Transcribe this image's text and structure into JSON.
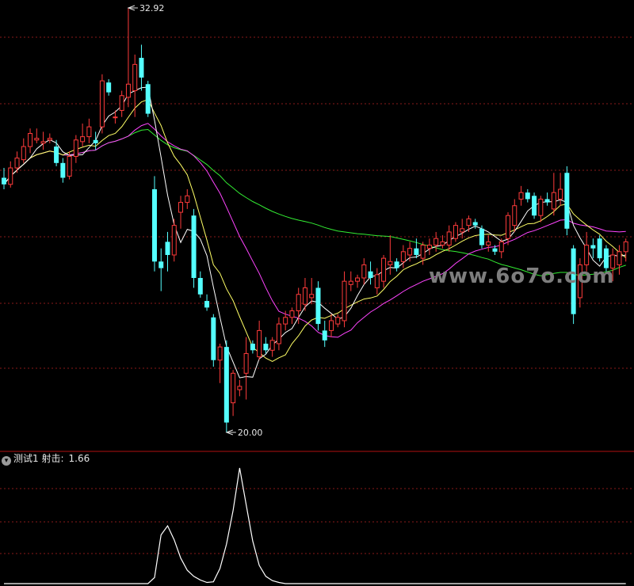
{
  "watermark": "www.6o7o.com",
  "indicator": {
    "name": "测试1",
    "label": "射击:",
    "value": "1.66"
  },
  "colors": {
    "up": "#ff3b3b",
    "down": "#54ffff",
    "ma5": "#ffffff",
    "ma10": "#ffff66",
    "ma20": "#ff44ff",
    "ma60": "#33ee33",
    "grid": "#8a1a1a",
    "separator": "#b01010",
    "indicator_line": "#ffffff"
  },
  "chart_data": [
    {
      "type": "candlestick",
      "ylim": [
        20.0,
        32.92
      ],
      "annotations": [
        {
          "label": "32.92",
          "value": 32.92,
          "kind": "high"
        },
        {
          "label": "20.00",
          "value": 20.0,
          "kind": "low"
        }
      ],
      "ohlc": [
        [
          27.75,
          28.05,
          27.4,
          27.55
        ],
        [
          27.55,
          28.25,
          27.45,
          28.05
        ],
        [
          28.05,
          28.55,
          27.9,
          28.35
        ],
        [
          28.3,
          28.95,
          28.2,
          28.7
        ],
        [
          28.7,
          29.25,
          28.5,
          29.1
        ],
        [
          28.9,
          29.25,
          28.8,
          28.95
        ],
        [
          28.8,
          29.15,
          28.6,
          28.85
        ],
        [
          28.9,
          29.1,
          28.8,
          28.95
        ],
        [
          28.7,
          28.9,
          28.1,
          28.2
        ],
        [
          28.2,
          28.35,
          27.6,
          27.75
        ],
        [
          27.8,
          28.55,
          27.7,
          28.4
        ],
        [
          28.4,
          29.05,
          28.2,
          28.9
        ],
        [
          28.85,
          29.4,
          28.7,
          29.0
        ],
        [
          29.0,
          29.55,
          28.8,
          29.3
        ],
        [
          28.9,
          29.15,
          28.6,
          28.8
        ],
        [
          29.3,
          30.9,
          29.1,
          30.7
        ],
        [
          30.65,
          30.75,
          30.25,
          30.35
        ],
        [
          29.6,
          29.8,
          29.4,
          29.6
        ],
        [
          29.8,
          30.4,
          29.6,
          30.25
        ],
        [
          30.2,
          32.92,
          29.9,
          30.6
        ],
        [
          30.4,
          31.5,
          29.6,
          31.2
        ],
        [
          31.4,
          31.8,
          30.4,
          30.8
        ],
        [
          30.6,
          30.7,
          29.6,
          29.7
        ],
        [
          27.4,
          27.8,
          24.9,
          25.2
        ],
        [
          25.2,
          25.6,
          24.3,
          25.0
        ],
        [
          25.8,
          26.1,
          24.9,
          25.4
        ],
        [
          25.4,
          26.5,
          25.2,
          26.3
        ],
        [
          26.7,
          27.2,
          26.2,
          27.0
        ],
        [
          27.0,
          27.4,
          26.8,
          27.2
        ],
        [
          26.6,
          26.8,
          24.4,
          24.7
        ],
        [
          24.7,
          24.9,
          24.1,
          24.2
        ],
        [
          24.0,
          24.2,
          23.7,
          23.8
        ],
        [
          23.5,
          23.6,
          22.0,
          22.2
        ],
        [
          22.2,
          22.7,
          21.5,
          22.6
        ],
        [
          22.6,
          22.8,
          20.0,
          20.3
        ],
        [
          20.9,
          21.9,
          20.5,
          21.8
        ],
        [
          21.3,
          21.6,
          21.1,
          21.4
        ],
        [
          21.8,
          22.9,
          21.0,
          22.4
        ],
        [
          22.7,
          22.8,
          22.4,
          22.5
        ],
        [
          22.3,
          23.4,
          22.2,
          23.1
        ],
        [
          22.7,
          22.9,
          22.4,
          22.5
        ],
        [
          22.5,
          22.9,
          22.3,
          22.8
        ],
        [
          22.7,
          23.5,
          22.5,
          23.3
        ],
        [
          23.3,
          23.7,
          23.1,
          23.5
        ],
        [
          23.5,
          23.8,
          23.3,
          23.7
        ],
        [
          23.7,
          24.4,
          23.3,
          24.2
        ],
        [
          23.9,
          24.7,
          23.7,
          24.4
        ],
        [
          24.1,
          24.7,
          23.9,
          24.2
        ],
        [
          24.4,
          24.6,
          23.1,
          23.3
        ],
        [
          23.1,
          23.4,
          22.6,
          22.8
        ],
        [
          23.1,
          23.6,
          22.9,
          23.4
        ],
        [
          23.3,
          23.6,
          23.2,
          23.5
        ],
        [
          23.4,
          24.9,
          23.2,
          24.6
        ],
        [
          24.5,
          24.9,
          24.3,
          24.6
        ],
        [
          24.6,
          24.8,
          24.4,
          24.7
        ],
        [
          24.7,
          25.3,
          24.5,
          25.1
        ],
        [
          24.9,
          25.2,
          24.5,
          24.7
        ],
        [
          24.4,
          25.0,
          24.2,
          24.8
        ],
        [
          24.6,
          25.4,
          24.4,
          25.3
        ],
        [
          25.1,
          26.0,
          24.8,
          25.2
        ],
        [
          25.2,
          25.3,
          24.9,
          25.0
        ],
        [
          25.2,
          25.7,
          25.0,
          25.5
        ],
        [
          25.4,
          25.8,
          25.2,
          25.6
        ],
        [
          25.6,
          25.9,
          25.3,
          25.4
        ],
        [
          25.3,
          25.8,
          25.1,
          25.7
        ],
        [
          25.6,
          25.9,
          25.4,
          25.7
        ],
        [
          25.7,
          26.1,
          25.5,
          25.9
        ],
        [
          25.7,
          26.0,
          25.6,
          25.8
        ],
        [
          25.7,
          26.3,
          25.5,
          26.1
        ],
        [
          25.9,
          26.4,
          25.8,
          26.3
        ],
        [
          26.1,
          26.5,
          25.9,
          26.2
        ],
        [
          26.3,
          26.6,
          26.1,
          26.5
        ],
        [
          26.4,
          26.5,
          26.2,
          26.3
        ],
        [
          26.2,
          26.3,
          25.6,
          25.7
        ],
        [
          25.7,
          26.0,
          25.5,
          25.8
        ],
        [
          25.6,
          25.7,
          25.4,
          25.5
        ],
        [
          25.5,
          25.9,
          25.3,
          25.8
        ],
        [
          25.9,
          26.7,
          25.7,
          26.6
        ],
        [
          26.3,
          27.1,
          26.1,
          26.9
        ],
        [
          27.1,
          27.5,
          26.9,
          27.3
        ],
        [
          27.3,
          27.4,
          27.0,
          27.1
        ],
        [
          27.2,
          27.3,
          26.5,
          26.6
        ],
        [
          26.6,
          27.2,
          26.4,
          27.1
        ],
        [
          27.1,
          27.3,
          26.9,
          27.0
        ],
        [
          26.8,
          27.9,
          26.6,
          27.3
        ],
        [
          27.1,
          27.9,
          26.9,
          27.4
        ],
        [
          27.9,
          28.1,
          26.0,
          26.2
        ],
        [
          25.6,
          25.7,
          23.3,
          23.6
        ],
        [
          24.1,
          25.3,
          23.8,
          25.1
        ],
        [
          25.1,
          26.1,
          24.9,
          25.7
        ],
        [
          25.7,
          25.9,
          25.3,
          25.6
        ],
        [
          25.9,
          26.0,
          25.2,
          25.3
        ],
        [
          25.6,
          25.7,
          24.9,
          25.0
        ],
        [
          25.0,
          25.6,
          24.6,
          25.4
        ],
        [
          25.1,
          25.7,
          24.8,
          25.5
        ],
        [
          25.5,
          25.9,
          25.2,
          25.8
        ]
      ]
    },
    {
      "type": "line",
      "series": [
        {
          "name": "射击",
          "last_value": 1.66,
          "values": [
            0,
            0,
            0,
            0,
            0,
            0,
            0,
            0,
            0,
            0,
            0,
            0,
            0,
            0,
            0,
            0,
            0,
            0,
            0,
            0,
            0,
            0,
            0,
            0.1,
            0.8,
            0.95,
            0.72,
            0.42,
            0.22,
            0.12,
            0.06,
            0.02,
            0.03,
            0.25,
            0.65,
            1.2,
            1.9,
            1.3,
            0.7,
            0.3,
            0.12,
            0.05,
            0.02,
            0,
            0,
            0,
            0,
            0,
            0,
            0,
            0,
            0,
            0,
            0,
            0,
            0,
            0,
            0,
            0,
            0,
            0,
            0,
            0,
            0,
            0,
            0,
            0,
            0,
            0,
            0,
            0,
            0,
            0,
            0,
            0,
            0,
            0,
            0,
            0,
            0,
            0,
            0,
            0,
            0,
            0,
            0,
            0,
            0,
            0,
            0,
            0,
            0,
            0,
            0,
            0,
            0
          ]
        }
      ]
    }
  ]
}
